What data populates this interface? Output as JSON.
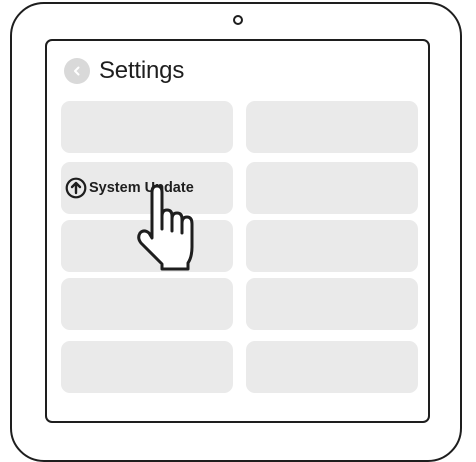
{
  "screen": {
    "title": "Settings",
    "back_icon": "chevron-left-icon",
    "update_tile": {
      "label": "System Update",
      "icon": "arrow-up-circle-icon"
    },
    "pointer": "hand-pointer-icon"
  },
  "colors": {
    "outline": "#1e1e1e",
    "tile": "#eaeaea",
    "back_button": "#d9d9d9"
  }
}
